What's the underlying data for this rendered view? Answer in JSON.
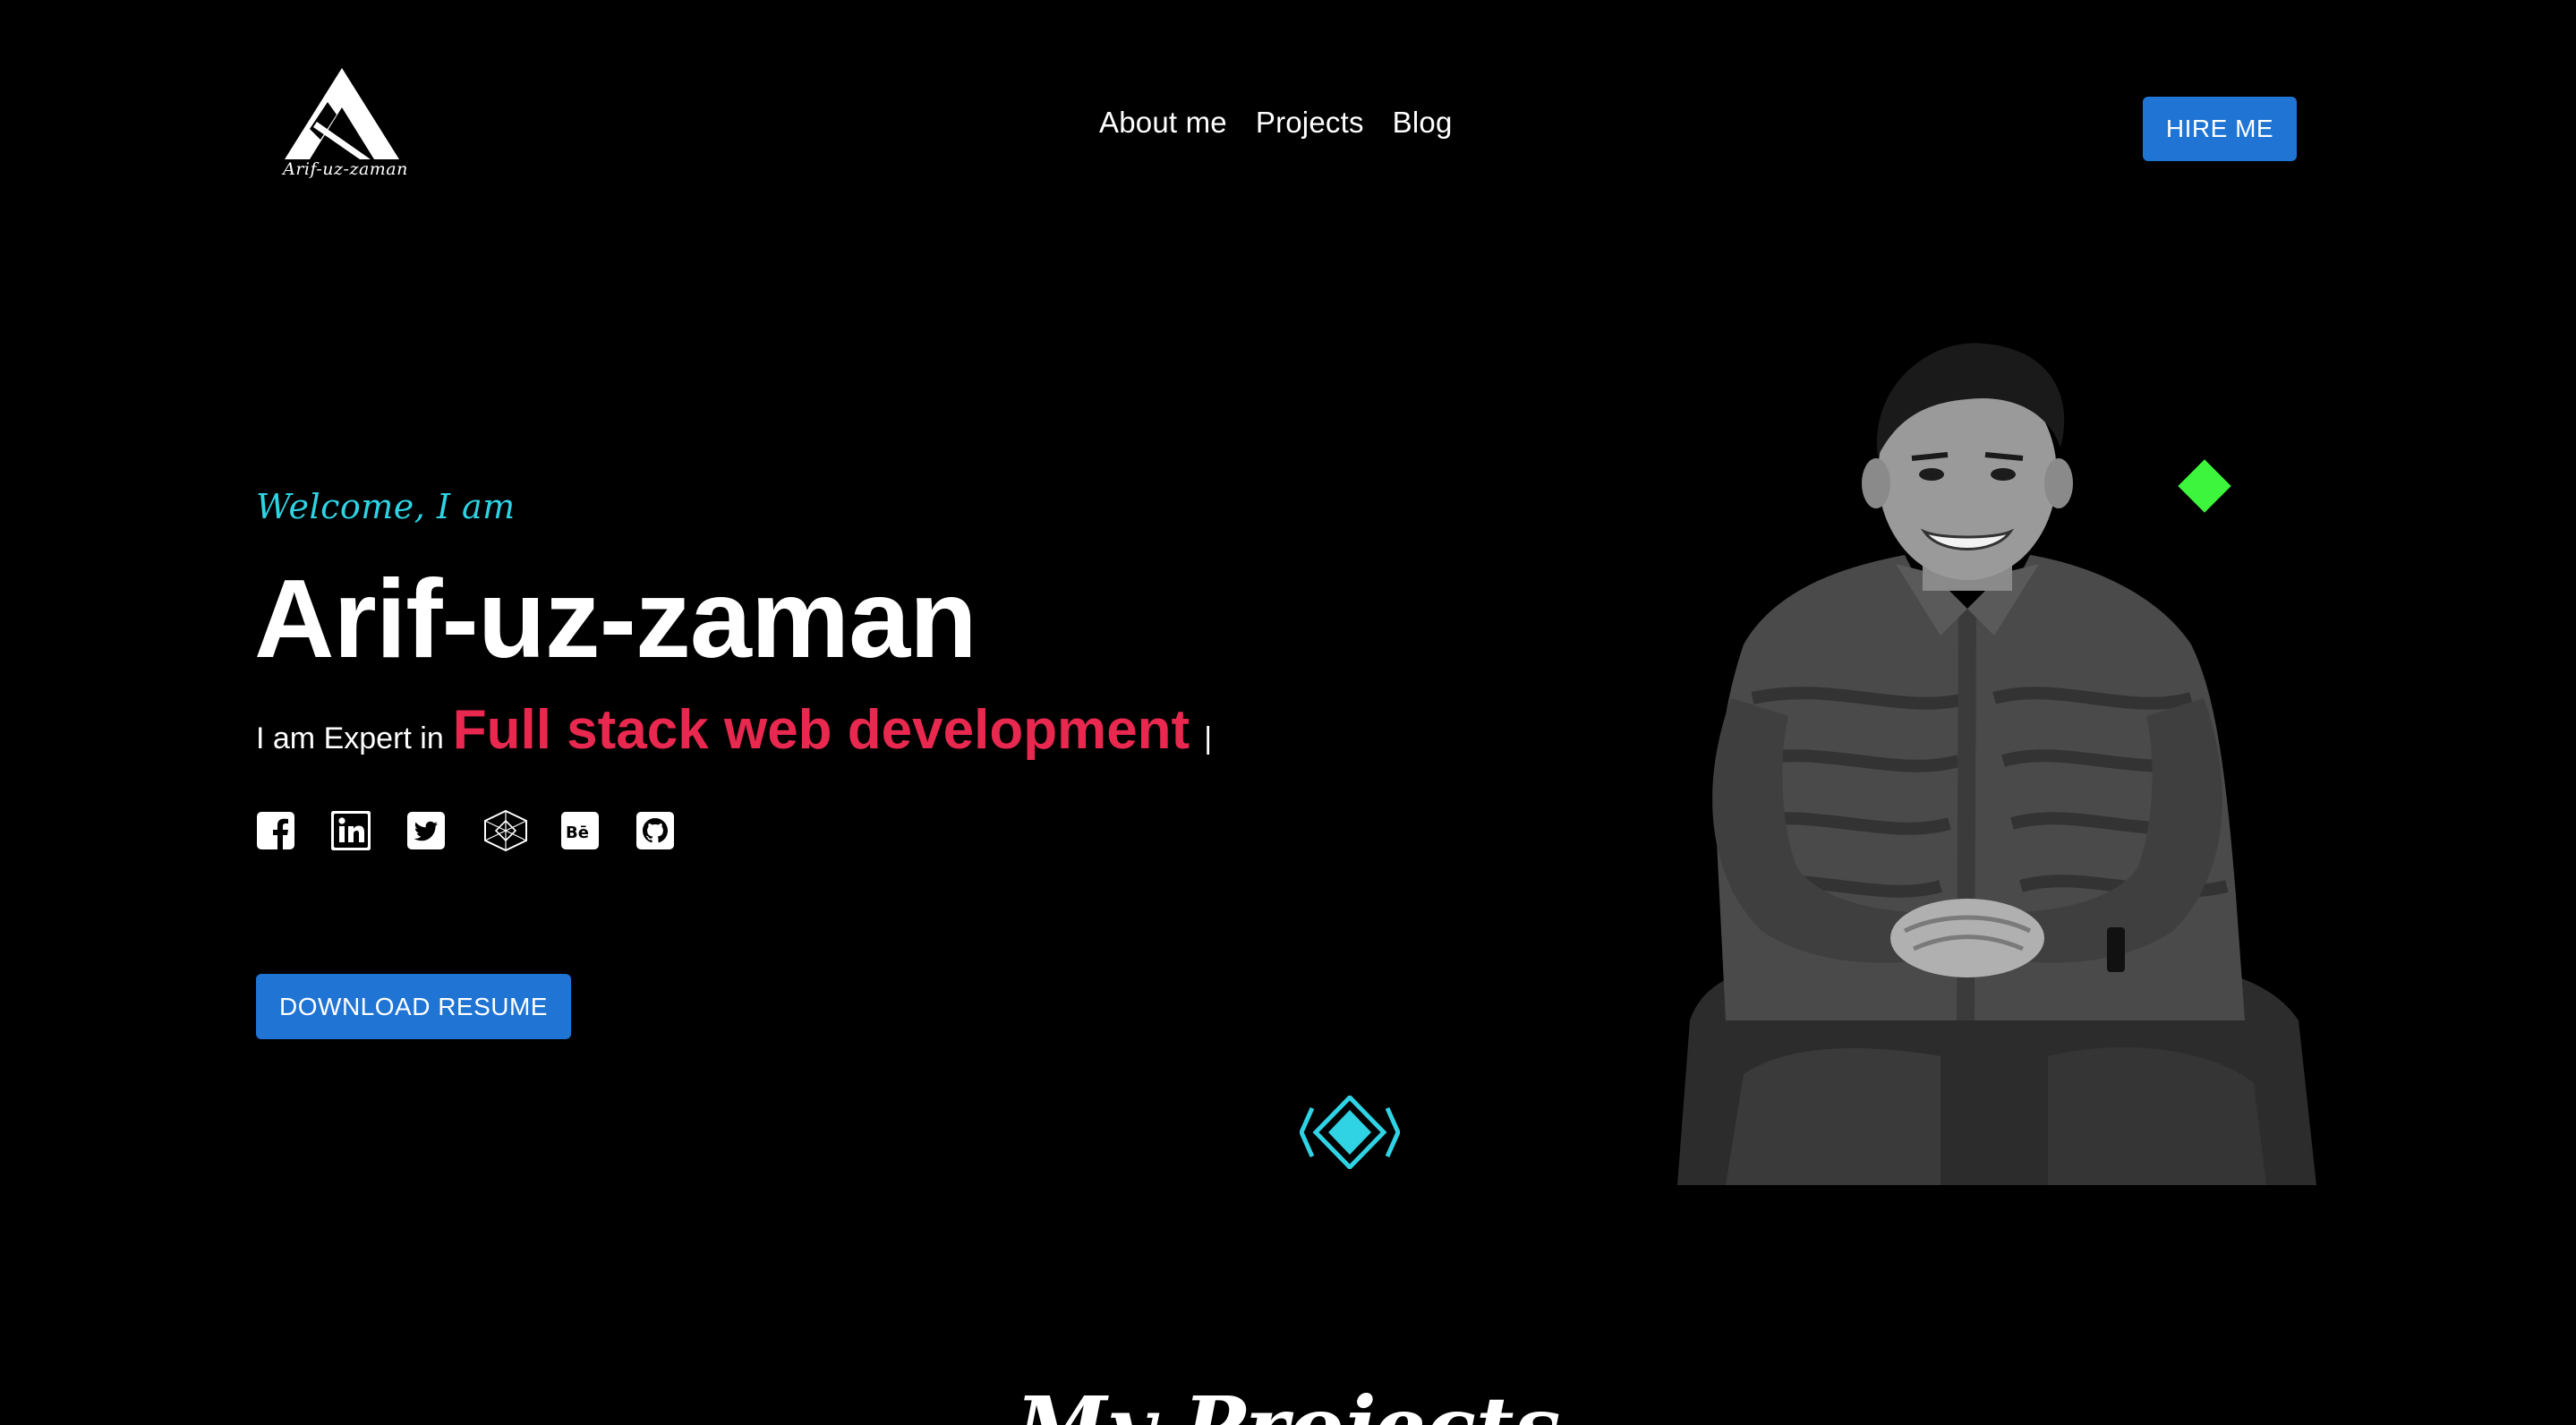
{
  "header": {
    "logo_text": "Arif-uz-zaman",
    "nav": [
      "About me",
      "Projects",
      "Blog"
    ],
    "hire_button": "HIRE ME"
  },
  "hero": {
    "welcome": "Welcome, I am",
    "name": "Arif-uz-zaman",
    "tagline_prefix": "I am Expert in",
    "tagline_skill": "Full stack web development",
    "cursor": "|",
    "socials": [
      "facebook-icon",
      "linkedin-icon",
      "twitter-icon",
      "codepen-icon",
      "behance-icon",
      "github-icon"
    ],
    "download_button": "DOWNLOAD RESUME"
  },
  "section": {
    "title": "My Projects"
  },
  "colors": {
    "background": "#000000",
    "accent_blue": "#1f74d4",
    "accent_pink": "#e9284f",
    "accent_cyan": "#2fd3e4",
    "accent_green": "#3cf53c"
  }
}
